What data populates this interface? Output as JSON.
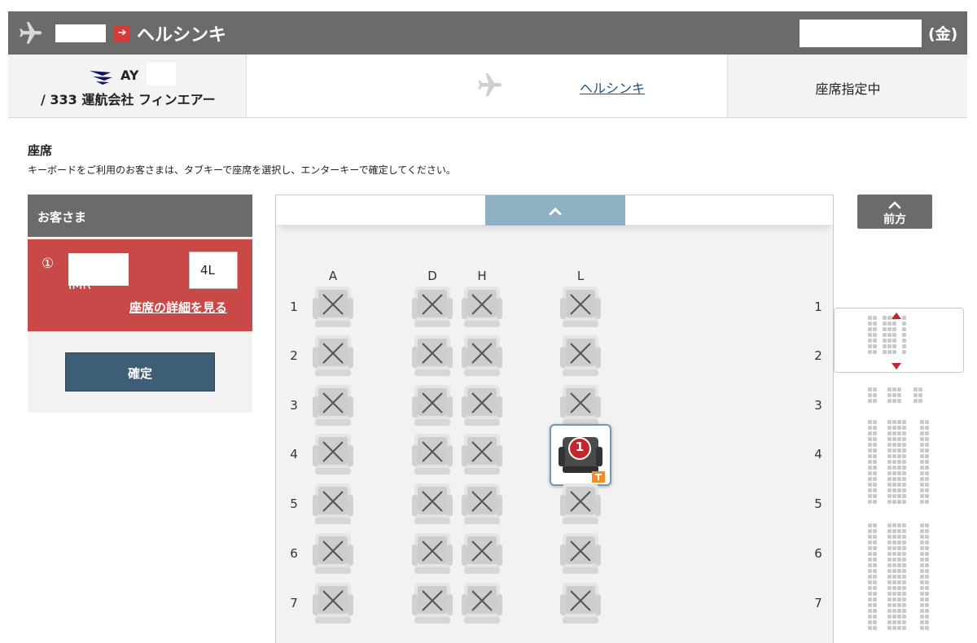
{
  "header": {
    "destination": "ヘルシンキ",
    "day_of_week": "(金)"
  },
  "flight": {
    "code_prefix": "AY",
    "operator": "/ 333 運航会社 フィンエアー",
    "destination_link": "ヘルシンキ",
    "status": "座席指定中"
  },
  "intro": {
    "title": "座席",
    "note": "キーボードをご利用のお客さまは、タブキーで座席を選択し、エンターキーで確定してください。"
  },
  "passengers": {
    "header": "お客さま",
    "items": [
      {
        "number": "①",
        "type": "IMR",
        "seat": "4L",
        "detail_link": "座席の詳細を見る"
      }
    ],
    "confirm_label": "確定"
  },
  "seatmap": {
    "columns": [
      "A",
      "D",
      "H",
      "L"
    ],
    "rows": [
      "1",
      "2",
      "3",
      "4",
      "5",
      "6",
      "7"
    ],
    "selected": {
      "row": "4",
      "col": "L",
      "badge": "1"
    },
    "forward_label": "前方",
    "colors": {
      "selected_badge": "#c0282d",
      "panel_red": "#c94848",
      "button": "#3e5e75"
    }
  }
}
